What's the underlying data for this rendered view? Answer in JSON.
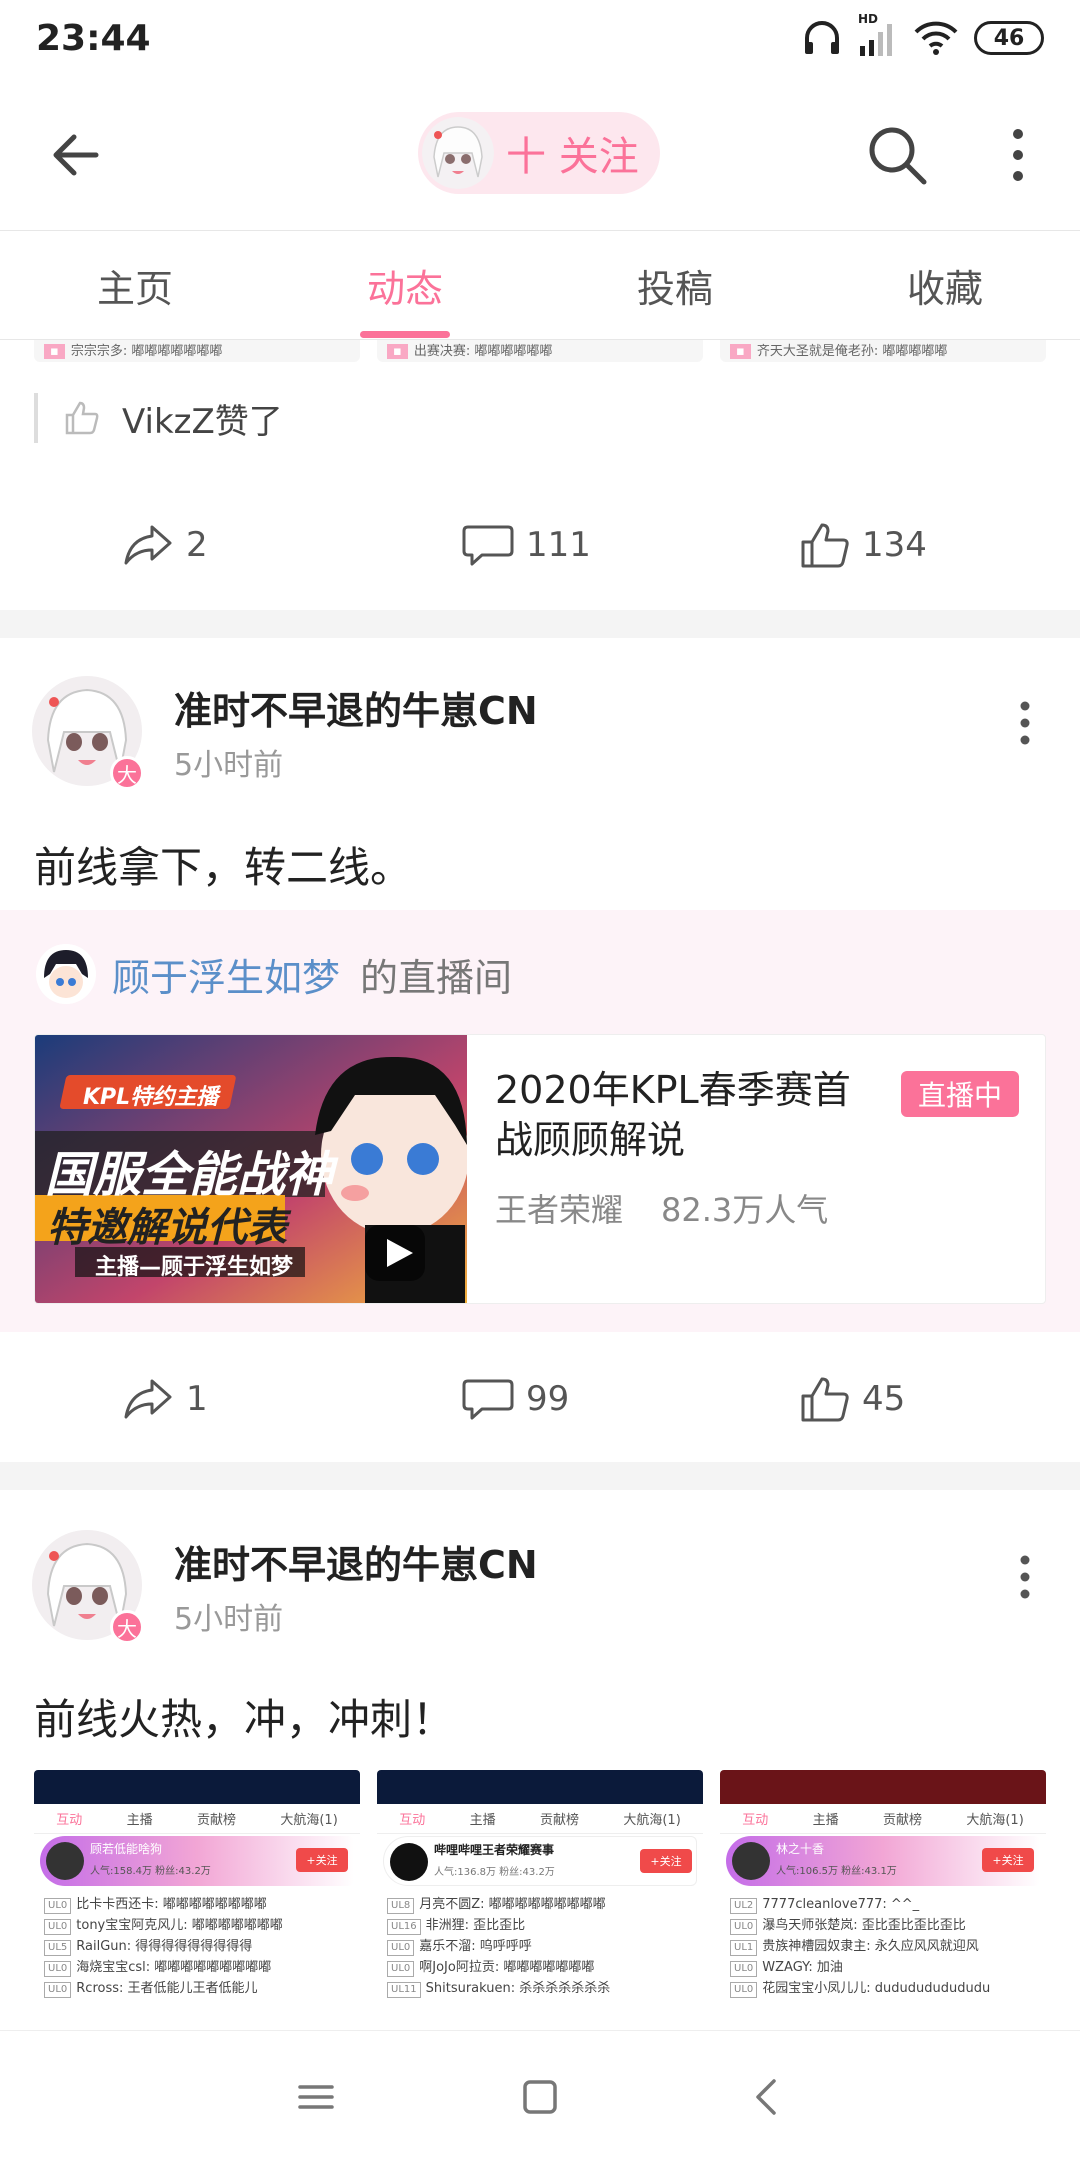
{
  "status_bar": {
    "time": "23:44",
    "battery": "46",
    "network_label": "HD"
  },
  "top_bar": {
    "follow_label": "十 关注"
  },
  "tabs": [
    {
      "label": "主页"
    },
    {
      "label": "动态"
    },
    {
      "label": "投稿"
    },
    {
      "label": "收藏"
    }
  ],
  "previous_post": {
    "strip_texts": [
      "宗宗宗多: 嘟嘟嘟嘟嘟嘟嘟",
      "出赛决赛: 嘟嘟嘟嘟嘟嘟",
      "齐天大圣就是俺老孙: 嘟嘟嘟嘟嘟"
    ],
    "liked_by": "VikzZ赞了",
    "shares": "2",
    "comments": "111",
    "likes": "134"
  },
  "posts": [
    {
      "author": "准时不早退的牛崽CN",
      "time": "5小时前",
      "badge": "大",
      "text": "前线拿下，转二线。",
      "live": {
        "owner": "顾于浮生如梦",
        "owner_suffix": "的直播间",
        "title": "2020年KPL春季赛首战顾顾解说",
        "status": "直播中",
        "category": "王者荣耀",
        "popularity": "82.3万人气",
        "thumb_tag": "KPL特约主播",
        "thumb_line1": "国服全能战神",
        "thumb_line2": "特邀解说代表",
        "thumb_line3": "主播—顾于浮生如梦"
      },
      "shares": "1",
      "comments": "99",
      "likes": "45"
    },
    {
      "author": "准时不早退的牛崽CN",
      "time": "5小时前",
      "badge": "大",
      "text": "前线火热，冲，冲刺！",
      "screenshots": [
        {
          "tabs": [
            "互动",
            "主播",
            "贡献榜",
            "大航海(1)"
          ],
          "streamer": "顾若低能啥狗",
          "follow": "+关注",
          "stats": "人气:158.4万 粉丝:43.2万",
          "lines": [
            "比卡卡西还卡: 嘟嘟嘟嘟嘟嘟嘟嘟",
            "tony宝宝阿克风儿: 嘟嘟嘟嘟嘟嘟嘟",
            "RailGun: 得得得得得得得得得",
            "海烧宝宝csl: 嘟嘟嘟嘟嘟嘟嘟嘟嘟",
            "Rcross: 王者低能儿王者低能儿"
          ]
        },
        {
          "tabs": [
            "互动",
            "主播",
            "贡献榜",
            "大航海(1)"
          ],
          "streamer": "哔哩哔哩王者荣耀赛事",
          "follow": "+关注",
          "stats": "人气:136.8万 粉丝:43.2万",
          "lines": [
            "月亮不圆Z: 嘟嘟嘟嘟嘟嘟嘟嘟嘟",
            "非洲狸: 歪比歪比",
            "嘉乐不溜: 呜呼呼呼",
            "啊JoJo阿拉贡: 嘟嘟嘟嘟嘟嘟嘟",
            "Shitsurakuen: 杀杀杀杀杀杀杀"
          ]
        },
        {
          "tabs": [
            "互动",
            "主播",
            "贡献榜",
            "大航海(1)"
          ],
          "streamer": "林之十香",
          "follow": "+关注",
          "stats": "人气:106.5万 粉丝:43.1万",
          "lines": [
            "7777cleanlove777: ^^_",
            "瀑鸟天师张楚岚: 歪比歪比歪比歪比",
            "贵族神槽园奴隶主: 永久应风风就迎风",
            "WZAGY: 加油",
            "花园宝宝小凤儿儿: dududududududu"
          ]
        }
      ]
    }
  ],
  "colors": {
    "accent": "#fb7299",
    "link": "#5b8fc9"
  }
}
